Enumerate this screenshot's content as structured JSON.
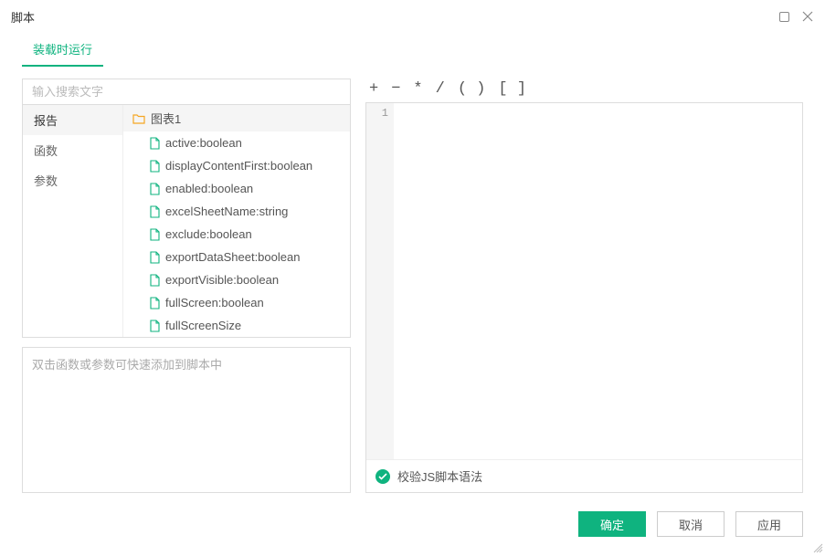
{
  "window": {
    "title": "脚本"
  },
  "tabs": {
    "active": "装载时运行"
  },
  "search": {
    "placeholder": "输入搜索文字"
  },
  "categories": [
    {
      "label": "报告",
      "selected": true
    },
    {
      "label": "函数",
      "selected": false
    },
    {
      "label": "参数",
      "selected": false
    }
  ],
  "tree": {
    "folder": "图表1",
    "items": [
      "active:boolean",
      "displayContentFirst:boolean",
      "enabled:boolean",
      "excelSheetName:string",
      "exclude:boolean",
      "exportDataSheet:boolean",
      "exportVisible:boolean",
      "fullScreen:boolean",
      "fullScreenSize"
    ]
  },
  "hint": "双击函数或参数可快速添加到脚本中",
  "operators": {
    "plus": "+",
    "minus": "−",
    "star": "*",
    "slash": "/",
    "parens": "( )",
    "brackets": "[ ]"
  },
  "editor": {
    "line_number": "1",
    "content": ""
  },
  "validate": {
    "label": "校验JS脚本语法"
  },
  "buttons": {
    "ok": "确定",
    "cancel": "取消",
    "apply": "应用"
  }
}
